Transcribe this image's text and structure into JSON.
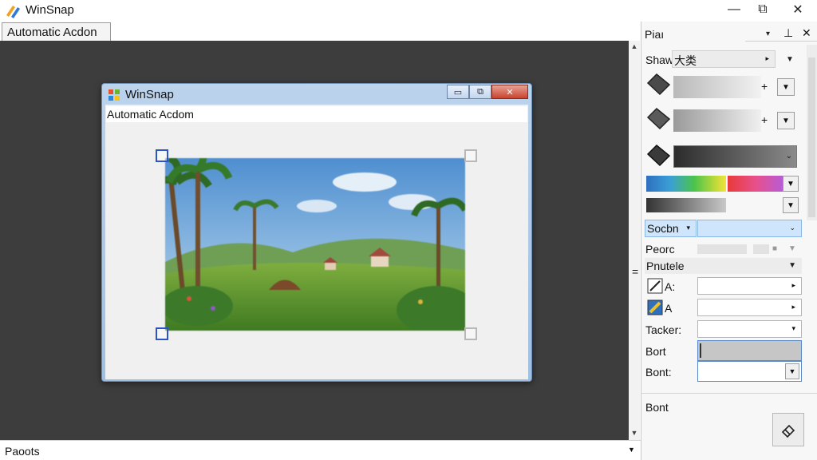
{
  "app": {
    "title": "WinSnap"
  },
  "window_controls": {
    "minimize": "—",
    "maximize": "⧉",
    "close": "✕"
  },
  "tab": {
    "label": "Automatic Acdon"
  },
  "inner_window": {
    "title": "WinSnap",
    "label": "Automatic Acdom",
    "controls": {
      "minimize": "▭",
      "maximize": "⧉",
      "close": "✕"
    }
  },
  "panel": {
    "header": "Piaı",
    "header_icons": [
      "▾",
      "⊥",
      "✕"
    ],
    "shadow": {
      "label": "Shaw",
      "value": "大类"
    },
    "section_select": {
      "label": "Socbn"
    },
    "row_label": "Peorc",
    "properties_header": "Pnutele",
    "fields": [
      {
        "label": "A:"
      },
      {
        "label": "A"
      },
      {
        "label": "Tacker:"
      },
      {
        "label": "Bort"
      },
      {
        "label": "Bont:"
      }
    ],
    "footer_label": "Bont"
  },
  "colors": {
    "canvas": "#3d3d3d",
    "accent_blue": "#2c54c4",
    "selection": "#cfe5fb"
  },
  "statusbar": {
    "text": "Paoots"
  }
}
